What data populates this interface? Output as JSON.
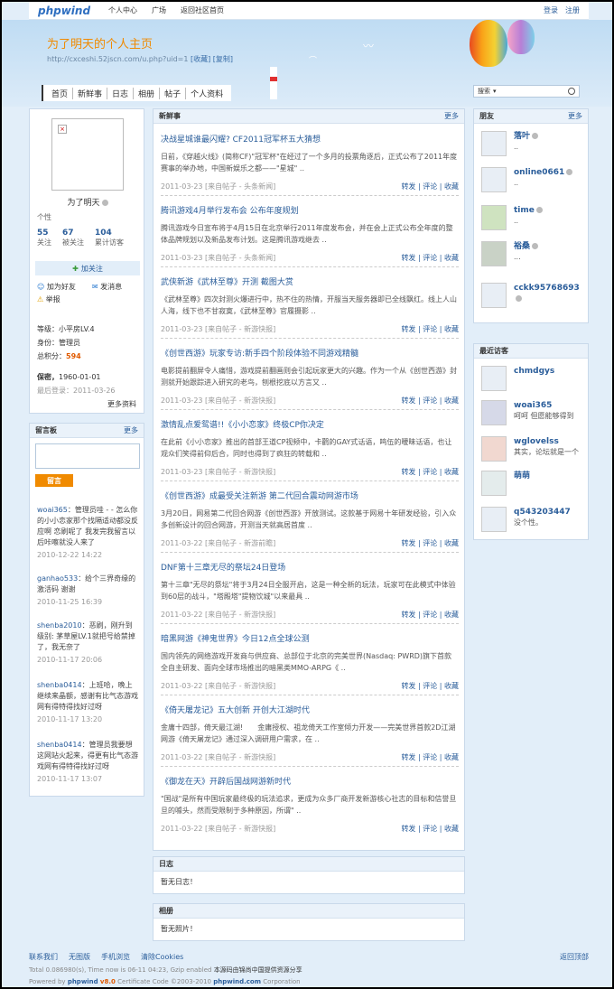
{
  "topbar": {
    "logo_text": "phpwind",
    "nav": [
      "个人中心",
      "广场",
      "返回社区首页"
    ],
    "login": "登录",
    "register": "注册"
  },
  "header": {
    "title": "为了明天的个人主页",
    "url": "http://cxceshi.52jscn.com/u.php?uid=1",
    "collect": "[收藏]",
    "copy": "[复制]",
    "nav": [
      "首页",
      "新鲜事",
      "日志",
      "相册",
      "帖子",
      "个人资料"
    ],
    "search_label": "搜索"
  },
  "profile": {
    "name": "为了明天",
    "sign": "个性",
    "stats": [
      {
        "value": "55",
        "label": "关注"
      },
      {
        "value": "67",
        "label": "被关注"
      },
      {
        "value": "104",
        "label": "累计访客"
      }
    ],
    "follow": "加关注",
    "add_friend": "加为好友",
    "send_msg": "发消息",
    "report": "举报",
    "level_label": "等级：",
    "level": "小平房LV.4",
    "role_label": "身份：",
    "role": "管理员",
    "points_label": "总积分：",
    "points": "594",
    "secret_label": "保密，",
    "birthday": "1960-01-01",
    "last_login_label": "最后登录：",
    "last_login": "2011-03-26",
    "more": "更多资料"
  },
  "guestbook": {
    "title": "留言板",
    "more": "更多",
    "submit": "留言",
    "messages": [
      {
        "who": "woai365",
        "text": "：管理员哇 - - 怎么你的小小恋家那个找隔适动都没反应啊 恋刷呢了 我发完我留言以后咔嚓就没人来了",
        "time": "2010-12-22 14:22"
      },
      {
        "who": "ganhao533",
        "text": "：给个三界奇缘的激活码 谢谢",
        "time": "2010-11-25 16:39"
      },
      {
        "who": "shenba2010",
        "text": "：恶刷，刚升到级别: 茅草屋LV.1就把号给禁掉了，我无奈了",
        "time": "2010-11-17 20:06"
      },
      {
        "who": "shenba0414",
        "text": "：上班哈，晚上继续来晶额，感谢有比气态游戏网有得特得找好过呀",
        "time": "2010-11-17 13:20"
      },
      {
        "who": "shenba0414",
        "text": "：管理员我要想这网站火起来，得更有比气态游戏网有得特得找好过呀",
        "time": "2010-11-17 13:07"
      }
    ]
  },
  "feed": {
    "title": "新鲜事",
    "more": "更多",
    "ops": "转发 | 评论 | 收藏",
    "items": [
      {
        "title": "决战星城谁最闪耀? CF2011冠军杯五大猜想",
        "desc": "日前，《穿越火线》(简称CF)\"冠军杯\"在经过了一个多月的投票角逐后，正式公布了2011年度赛事的举办地，中国新娱乐之都——\"星城\" ..",
        "meta": "2011-03-23 [来自帖子 - 头条新闻]"
      },
      {
        "title": "腾讯游戏4月举行发布会 公布年度规划",
        "desc": "腾讯游戏今日宣布将于4月15日在北京举行2011年度发布会，并在会上正式公布全年度的整体品牌规划以及新品发布计划。这是腾讯游戏继去 ..",
        "meta": "2011-03-23 [来自帖子 - 头条新闻]"
      },
      {
        "title": "武侠新游《武林至尊》开测 截图大赏",
        "desc": "《武林至尊》四次封测火爆进行中，热不住的热情，开服当天服务器即已全线飘红。线上人山人海，线下也不甘寂寞，《武林至尊》官履摄影 ..",
        "meta": "2011-03-23 [来自帖子 - 新游快报]"
      },
      {
        "title": "《创世西游》玩家专访:新手四个阶段体验不同游戏精髓",
        "desc": "电影提前翻屏令人痛惜，游戏提前翻画则会引起玩家更大的兴趣。作为一个从《创世西游》封测就开始跟踪进入研究的老鸟，刨根挖底以方言又 ..",
        "meta": "2011-03-23 [来自帖子 - 新游快报]"
      },
      {
        "title": "激情乱点爱鸳谱!!《小小恋家》终极CP你决定",
        "desc": "在此前《小小恋家》推出的首部王道CP视频中，卡鹳的GAY式话语，鸣伍的暧昧话语，也让观众们笑得前仰后合，同时也得到了疯狂的转载和 ..",
        "meta": "2011-03-23 [来自帖子 - 新游快报]"
      },
      {
        "title": "《创世西游》成最受关注新游 第二代回合震动网游市场",
        "desc": "3月20日，网易第二代回合网游《创世西游》开放测试。这款基于网易十年研发经验，引入众多创新设计的回合网游，开测当天就高居首度 ..",
        "meta": "2011-03-22 [来自帖子 - 新游前瞻]"
      },
      {
        "title": "DNF第十三章无尽的祭坛24日登场",
        "desc": "第十三章\"无尽的祭坛\"将于3月24日全服开启，这是一种全新的玩法，玩家可在此模式中体验到60层的战斗，\"塔殿塔\"提物饮城\"以来最具 ..",
        "meta": "2011-03-22 [来自帖子 - 新游快报]"
      },
      {
        "title": "暗黑网游《神鬼世界》今日12点全球公测",
        "desc": "国内领先的网络游戏开发商与供应商、总部位于北京的完美世界(Nasdaq: PWRD)旗下首款全自主研发、面向全球市场推出的暗黑类MMO-ARPG《 ..",
        "meta": "2011-03-22 [来自帖子 - 新游快报]"
      },
      {
        "title": "《倚天屠龙记》五大创新 开创大江湖时代",
        "desc": "金庸十四部，倚天最江湖!　　金庸授权、祖龙倚天工作室倾力开发——完美世界首款2D江湖网游《倚天屠龙记》通过深入调研用户需求，在 ..",
        "meta": "2011-03-22 [来自帖子 - 新游快报]"
      },
      {
        "title": "《御龙在天》开辟后国战网游新时代",
        "desc": "\"国战\"是所有中国玩家最终极的玩法追求，更成为众多厂商开发新游核心社志的目标和信誉旦旦的噱头，然而受限制于多种原因，所谓\" ..",
        "meta": "2011-03-22 [来自帖子 - 新游快报]"
      }
    ]
  },
  "diary": {
    "title": "日志",
    "empty": "暂无日志！"
  },
  "album": {
    "title": "相册",
    "empty": "暂无照片！"
  },
  "friends": {
    "title": "朋友",
    "more": "更多",
    "items": [
      {
        "name": "落叶",
        "sub": ".."
      },
      {
        "name": "online0661",
        "sub": ".."
      },
      {
        "name": "time",
        "sub": ".."
      },
      {
        "name": "裕桑",
        "sub": "..."
      },
      {
        "name": "cckk95768693",
        "sub": ""
      }
    ]
  },
  "visitors": {
    "title": "最近访客",
    "items": [
      {
        "name": "chmdgys",
        "sub": ""
      },
      {
        "name": "woai365",
        "sub": "呵呵 但愿能够得到"
      },
      {
        "name": "wglovelss",
        "sub": "其实，论坛就是一个"
      },
      {
        "name": "萌萌",
        "sub": ""
      },
      {
        "name": "q543203447",
        "sub": "没个性。"
      }
    ]
  },
  "footer": {
    "links": [
      "联系我们",
      "无图版",
      "手机浏览",
      "清除Cookies"
    ],
    "back_top": "返回顶部",
    "line1_a": "Total 0.086980(s), Time now is 06-11 04:23, Gzip enabled",
    "line1_b": "本源码由锦尚中国提供资源分享",
    "line2_a": "Powered by",
    "line2_b": "phpwind",
    "line2_c": "v8.0",
    "line2_d": "Certificate  Code ©2003-2010",
    "line2_e": "phpwind.com",
    "line2_f": "Corporation"
  }
}
